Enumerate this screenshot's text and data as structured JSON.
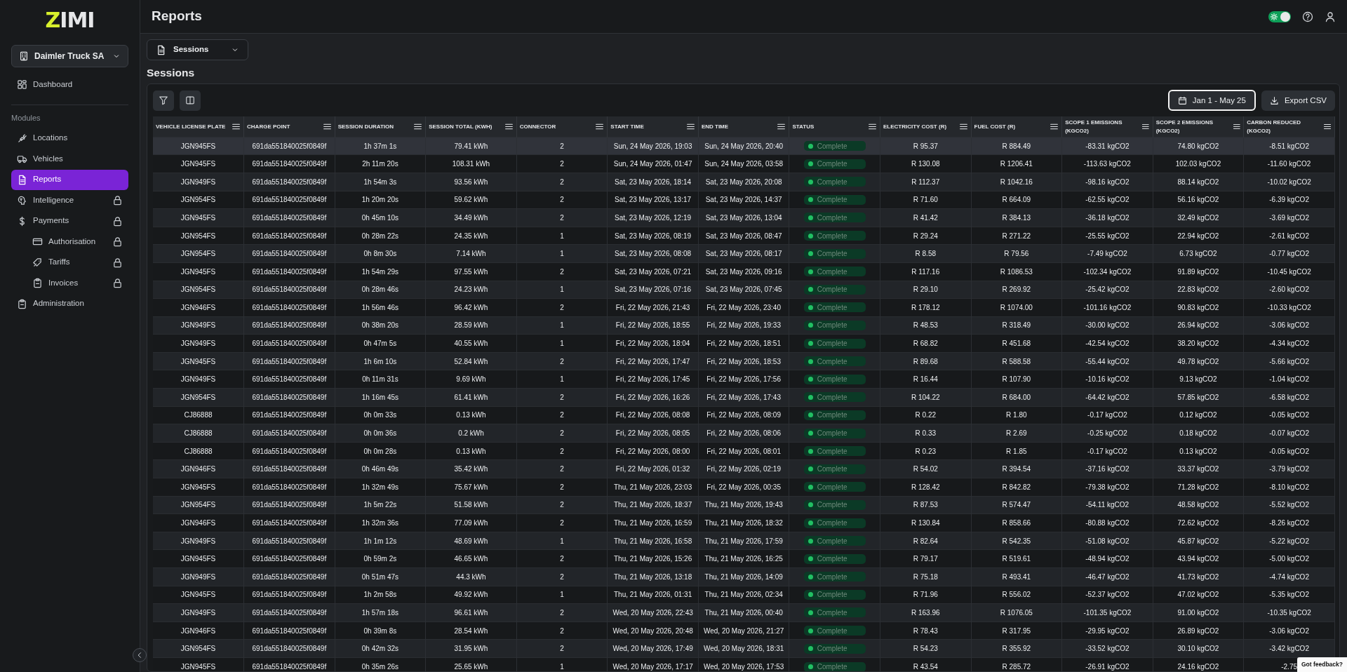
{
  "sidebar": {
    "logo": "ZIMI",
    "organization": "Daimler Truck SA",
    "top_items": [
      {
        "label": "Dashboard",
        "selected": false
      }
    ],
    "section_label": "Modules",
    "items": [
      {
        "label": "Locations",
        "selected": false,
        "locked": false
      },
      {
        "label": "Vehicles",
        "selected": false,
        "locked": false
      },
      {
        "label": "Reports",
        "selected": true,
        "locked": false
      },
      {
        "label": "Intelligence",
        "selected": false,
        "locked": true
      },
      {
        "label": "Payments",
        "selected": false,
        "locked": true,
        "children": [
          {
            "label": "Authorisation",
            "selected": false,
            "locked": true
          },
          {
            "label": "Tariffs",
            "selected": false,
            "locked": true
          },
          {
            "label": "Invoices",
            "selected": false,
            "locked": true
          }
        ]
      },
      {
        "label": "Administration",
        "selected": false,
        "locked": false
      }
    ]
  },
  "header": {
    "title": "Reports",
    "theme_toggle": {
      "on": true
    }
  },
  "report_selector": {
    "value": "Sessions"
  },
  "section_title": "Sessions",
  "toolbar": {
    "date_range": "Jan 1 - May 25",
    "export": "Export CSV"
  },
  "table": {
    "columns": [
      {
        "label": "VEHICLE LICENSE PLATE",
        "kind": "text"
      },
      {
        "label": "CHARGE POINT",
        "kind": "text"
      },
      {
        "label": "SESSION DURATION",
        "kind": "text"
      },
      {
        "label": "SESSION TOTAL (KWH)",
        "kind": "text"
      },
      {
        "label": "CONNECTOR",
        "kind": "text"
      },
      {
        "label": "START TIME",
        "kind": "text"
      },
      {
        "label": "END TIME",
        "kind": "text"
      },
      {
        "label": "STATUS",
        "kind": "status"
      },
      {
        "label": "ELECTRICITY COST (R)",
        "kind": "text"
      },
      {
        "label": "FUEL COST (R)",
        "kind": "text"
      },
      {
        "label": "SCOPE 1 EMISSIONS (KGCO2)",
        "kind": "text"
      },
      {
        "label": "SCOPE 2 EMISSIONS (KGCO2)",
        "kind": "text"
      },
      {
        "label": "CARBON REDUCED (KGCO2)",
        "kind": "text"
      }
    ],
    "rows": [
      {
        "selected": true,
        "cells": [
          "JGN945FS",
          "691da551840025f0849f",
          "1h 37m 1s",
          "79.41 kWh",
          "2",
          "Sun, 24 May 2026, 19:03",
          "Sun, 24 May 2026, 20:40",
          "Complete",
          "R 95.37",
          "R 884.49",
          "-83.31 kgCO2",
          "74.80 kgCO2",
          "-8.51 kgCO2"
        ]
      },
      {
        "selected": false,
        "cells": [
          "JGN945FS",
          "691da551840025f0849f",
          "2h 11m 20s",
          "108.31 kWh",
          "2",
          "Sun, 24 May 2026, 01:47",
          "Sun, 24 May 2026, 03:58",
          "Complete",
          "R 130.08",
          "R 1206.41",
          "-113.63 kgCO2",
          "102.03 kgCO2",
          "-11.60 kgCO2"
        ]
      },
      {
        "selected": false,
        "cells": [
          "JGN949FS",
          "691da551840025f0849f",
          "1h 54m 3s",
          "93.56 kWh",
          "2",
          "Sat, 23 May 2026, 18:14",
          "Sat, 23 May 2026, 20:08",
          "Complete",
          "R 112.37",
          "R 1042.16",
          "-98.16 kgCO2",
          "88.14 kgCO2",
          "-10.02 kgCO2"
        ]
      },
      {
        "selected": false,
        "cells": [
          "JGN954FS",
          "691da551840025f0849f",
          "1h 20m 20s",
          "59.62 kWh",
          "2",
          "Sat, 23 May 2026, 13:17",
          "Sat, 23 May 2026, 14:37",
          "Complete",
          "R 71.60",
          "R 664.09",
          "-62.55 kgCO2",
          "56.16 kgCO2",
          "-6.39 kgCO2"
        ]
      },
      {
        "selected": false,
        "cells": [
          "JGN945FS",
          "691da551840025f0849f",
          "0h 45m 10s",
          "34.49 kWh",
          "2",
          "Sat, 23 May 2026, 12:19",
          "Sat, 23 May 2026, 13:04",
          "Complete",
          "R 41.42",
          "R 384.13",
          "-36.18 kgCO2",
          "32.49 kgCO2",
          "-3.69 kgCO2"
        ]
      },
      {
        "selected": false,
        "cells": [
          "JGN954FS",
          "691da551840025f0849f",
          "0h 28m 22s",
          "24.35 kWh",
          "1",
          "Sat, 23 May 2026, 08:19",
          "Sat, 23 May 2026, 08:47",
          "Complete",
          "R 29.24",
          "R 271.22",
          "-25.55 kgCO2",
          "22.94 kgCO2",
          "-2.61 kgCO2"
        ]
      },
      {
        "selected": false,
        "cells": [
          "JGN954FS",
          "691da551840025f0849f",
          "0h 8m 30s",
          "7.14 kWh",
          "1",
          "Sat, 23 May 2026, 08:08",
          "Sat, 23 May 2026, 08:17",
          "Complete",
          "R 8.58",
          "R 79.56",
          "-7.49 kgCO2",
          "6.73 kgCO2",
          "-0.77 kgCO2"
        ]
      },
      {
        "selected": false,
        "cells": [
          "JGN945FS",
          "691da551840025f0849f",
          "1h 54m 29s",
          "97.55 kWh",
          "2",
          "Sat, 23 May 2026, 07:21",
          "Sat, 23 May 2026, 09:16",
          "Complete",
          "R 117.16",
          "R 1086.53",
          "-102.34 kgCO2",
          "91.89 kgCO2",
          "-10.45 kgCO2"
        ]
      },
      {
        "selected": false,
        "cells": [
          "JGN954FS",
          "691da551840025f0849f",
          "0h 28m 46s",
          "24.23 kWh",
          "1",
          "Sat, 23 May 2026, 07:16",
          "Sat, 23 May 2026, 07:45",
          "Complete",
          "R 29.10",
          "R 269.92",
          "-25.42 kgCO2",
          "22.83 kgCO2",
          "-2.60 kgCO2"
        ]
      },
      {
        "selected": false,
        "cells": [
          "JGN946FS",
          "691da551840025f0849f",
          "1h 56m 46s",
          "96.42 kWh",
          "2",
          "Fri, 22 May 2026, 21:43",
          "Fri, 22 May 2026, 23:40",
          "Complete",
          "R 178.12",
          "R 1074.00",
          "-101.16 kgCO2",
          "90.83 kgCO2",
          "-10.33 kgCO2"
        ]
      },
      {
        "selected": false,
        "cells": [
          "JGN949FS",
          "691da551840025f0849f",
          "0h 38m 20s",
          "28.59 kWh",
          "1",
          "Fri, 22 May 2026, 18:55",
          "Fri, 22 May 2026, 19:33",
          "Complete",
          "R 48.53",
          "R 318.49",
          "-30.00 kgCO2",
          "26.94 kgCO2",
          "-3.06 kgCO2"
        ]
      },
      {
        "selected": false,
        "cells": [
          "JGN949FS",
          "691da551840025f0849f",
          "0h 47m 5s",
          "40.55 kWh",
          "1",
          "Fri, 22 May 2026, 18:04",
          "Fri, 22 May 2026, 18:51",
          "Complete",
          "R 68.82",
          "R 451.68",
          "-42.54 kgCO2",
          "38.20 kgCO2",
          "-4.34 kgCO2"
        ]
      },
      {
        "selected": false,
        "cells": [
          "JGN945FS",
          "691da551840025f0849f",
          "1h 6m 10s",
          "52.84 kWh",
          "2",
          "Fri, 22 May 2026, 17:47",
          "Fri, 22 May 2026, 18:53",
          "Complete",
          "R 89.68",
          "R 588.58",
          "-55.44 kgCO2",
          "49.78 kgCO2",
          "-5.66 kgCO2"
        ]
      },
      {
        "selected": false,
        "cells": [
          "JGN949FS",
          "691da551840025f0849f",
          "0h 11m 31s",
          "9.69 kWh",
          "1",
          "Fri, 22 May 2026, 17:45",
          "Fri, 22 May 2026, 17:56",
          "Complete",
          "R 16.44",
          "R 107.90",
          "-10.16 kgCO2",
          "9.13 kgCO2",
          "-1.04 kgCO2"
        ]
      },
      {
        "selected": false,
        "cells": [
          "JGN954FS",
          "691da551840025f0849f",
          "1h 16m 45s",
          "61.41 kWh",
          "2",
          "Fri, 22 May 2026, 16:26",
          "Fri, 22 May 2026, 17:43",
          "Complete",
          "R 104.22",
          "R 684.00",
          "-64.42 kgCO2",
          "57.85 kgCO2",
          "-6.58 kgCO2"
        ]
      },
      {
        "selected": false,
        "cells": [
          "CJ86888",
          "691da551840025f0849f",
          "0h 0m 33s",
          "0.13 kWh",
          "2",
          "Fri, 22 May 2026, 08:08",
          "Fri, 22 May 2026, 08:09",
          "Complete",
          "R 0.22",
          "R 1.80",
          "-0.17 kgCO2",
          "0.12 kgCO2",
          "-0.05 kgCO2"
        ]
      },
      {
        "selected": false,
        "cells": [
          "CJ86888",
          "691da551840025f0849f",
          "0h 0m 36s",
          "0.2 kWh",
          "2",
          "Fri, 22 May 2026, 08:05",
          "Fri, 22 May 2026, 08:06",
          "Complete",
          "R 0.33",
          "R 2.69",
          "-0.25 kgCO2",
          "0.18 kgCO2",
          "-0.07 kgCO2"
        ]
      },
      {
        "selected": false,
        "cells": [
          "CJ86888",
          "691da551840025f0849f",
          "0h 0m 28s",
          "0.13 kWh",
          "2",
          "Fri, 22 May 2026, 08:00",
          "Fri, 22 May 2026, 08:01",
          "Complete",
          "R 0.23",
          "R 1.85",
          "-0.17 kgCO2",
          "0.13 kgCO2",
          "-0.05 kgCO2"
        ]
      },
      {
        "selected": false,
        "cells": [
          "JGN946FS",
          "691da551840025f0849f",
          "0h 46m 49s",
          "35.42 kWh",
          "2",
          "Fri, 22 May 2026, 01:32",
          "Fri, 22 May 2026, 02:19",
          "Complete",
          "R 54.02",
          "R 394.54",
          "-37.16 kgCO2",
          "33.37 kgCO2",
          "-3.79 kgCO2"
        ]
      },
      {
        "selected": false,
        "cells": [
          "JGN945FS",
          "691da551840025f0849f",
          "1h 32m 49s",
          "75.67 kWh",
          "2",
          "Thu, 21 May 2026, 23:03",
          "Fri, 22 May 2026, 00:35",
          "Complete",
          "R 128.42",
          "R 842.82",
          "-79.38 kgCO2",
          "71.28 kgCO2",
          "-8.10 kgCO2"
        ]
      },
      {
        "selected": false,
        "cells": [
          "JGN954FS",
          "691da551840025f0849f",
          "1h 5m 22s",
          "51.58 kWh",
          "2",
          "Thu, 21 May 2026, 18:37",
          "Thu, 21 May 2026, 19:43",
          "Complete",
          "R 87.53",
          "R 574.47",
          "-54.11 kgCO2",
          "48.58 kgCO2",
          "-5.52 kgCO2"
        ]
      },
      {
        "selected": false,
        "cells": [
          "JGN946FS",
          "691da551840025f0849f",
          "1h 32m 36s",
          "77.09 kWh",
          "2",
          "Thu, 21 May 2026, 16:59",
          "Thu, 21 May 2026, 18:32",
          "Complete",
          "R 130.84",
          "R 858.66",
          "-80.88 kgCO2",
          "72.62 kgCO2",
          "-8.26 kgCO2"
        ]
      },
      {
        "selected": false,
        "cells": [
          "JGN949FS",
          "691da551840025f0849f",
          "1h 1m 12s",
          "48.69 kWh",
          "1",
          "Thu, 21 May 2026, 16:58",
          "Thu, 21 May 2026, 17:59",
          "Complete",
          "R 82.64",
          "R 542.35",
          "-51.08 kgCO2",
          "45.87 kgCO2",
          "-5.22 kgCO2"
        ]
      },
      {
        "selected": false,
        "cells": [
          "JGN945FS",
          "691da551840025f0849f",
          "0h 59m 2s",
          "46.65 kWh",
          "2",
          "Thu, 21 May 2026, 15:26",
          "Thu, 21 May 2026, 16:25",
          "Complete",
          "R 79.17",
          "R 519.61",
          "-48.94 kgCO2",
          "43.94 kgCO2",
          "-5.00 kgCO2"
        ]
      },
      {
        "selected": false,
        "cells": [
          "JGN949FS",
          "691da551840025f0849f",
          "0h 51m 47s",
          "44.3 kWh",
          "2",
          "Thu, 21 May 2026, 13:18",
          "Thu, 21 May 2026, 14:09",
          "Complete",
          "R 75.18",
          "R 493.41",
          "-46.47 kgCO2",
          "41.73 kgCO2",
          "-4.74 kgCO2"
        ]
      },
      {
        "selected": false,
        "cells": [
          "JGN945FS",
          "691da551840025f0849f",
          "1h 2m 58s",
          "49.92 kWh",
          "1",
          "Thu, 21 May 2026, 01:31",
          "Thu, 21 May 2026, 02:34",
          "Complete",
          "R 71.96",
          "R 556.02",
          "-52.37 kgCO2",
          "47.02 kgCO2",
          "-5.35 kgCO2"
        ]
      },
      {
        "selected": false,
        "cells": [
          "JGN949FS",
          "691da551840025f0849f",
          "1h 57m 18s",
          "96.61 kWh",
          "2",
          "Wed, 20 May 2026, 22:43",
          "Thu, 21 May 2026, 00:40",
          "Complete",
          "R 163.96",
          "R 1076.05",
          "-101.35 kgCO2",
          "91.00 kgCO2",
          "-10.35 kgCO2"
        ]
      },
      {
        "selected": false,
        "cells": [
          "JGN946FS",
          "691da551840025f0849f",
          "0h 39m 8s",
          "28.54 kWh",
          "2",
          "Wed, 20 May 2026, 20:48",
          "Wed, 20 May 2026, 21:27",
          "Complete",
          "R 78.43",
          "R 317.95",
          "-29.95 kgCO2",
          "26.89 kgCO2",
          "-3.06 kgCO2"
        ]
      },
      {
        "selected": false,
        "cells": [
          "JGN954FS",
          "691da551840025f0849f",
          "0h 42m 32s",
          "31.95 kWh",
          "2",
          "Wed, 20 May 2026, 17:49",
          "Wed, 20 May 2026, 18:31",
          "Complete",
          "R 54.23",
          "R 355.92",
          "-33.52 kgCO2",
          "30.10 kgCO2",
          "-3.42 kgCO2"
        ]
      },
      {
        "selected": false,
        "cells": [
          "JGN945FS",
          "691da551840025f0849f",
          "0h 35m 26s",
          "25.65 kWh",
          "1",
          "Wed, 20 May 2026, 17:17",
          "Wed, 20 May 2026, 17:53",
          "Complete",
          "R 43.54",
          "R 285.72",
          "-26.91 kgCO2",
          "24.16 kgCO2",
          "-2.75"
        ]
      }
    ]
  },
  "feedback": "Got feedback?"
}
